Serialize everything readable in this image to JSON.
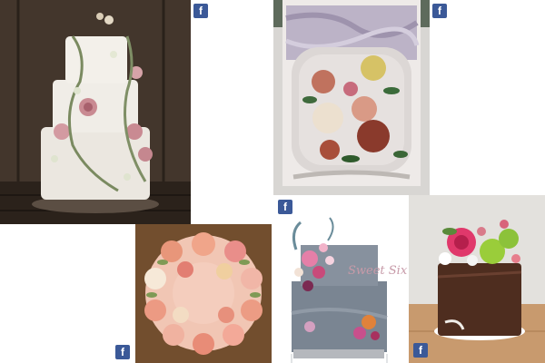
{
  "gallery": {
    "tiles": [
      {
        "name": "cake-rustic-three-tier",
        "description": "Three-tier white buttercream cake with pink roses and trailing greenery on wooden crate",
        "badge": "f"
      },
      {
        "name": "cake-painted-roses",
        "description": "Square cake with purple marble top and hand-painted vintage roses framed by piped shell border",
        "badge": "f"
      },
      {
        "name": "cake-buttercream-wreath",
        "description": "Round cake topped with a wreath of piped peach and pink buttercream roses",
        "badge": "f"
      },
      {
        "name": "cake-sweet-sixteen",
        "description": "Grey textured two-tier cake with cascading flowers and acrylic topper",
        "badge": "f",
        "topper_text": "Sweet Sixteen"
      },
      {
        "name": "cake-chocolate-wrap",
        "description": "Chocolate-wrapped cake topped with pink rose, green chrysanthemums and berries",
        "badge": "f"
      }
    ]
  },
  "colors": {
    "facebook_blue": "#3b5998",
    "background": "#ffffff"
  }
}
